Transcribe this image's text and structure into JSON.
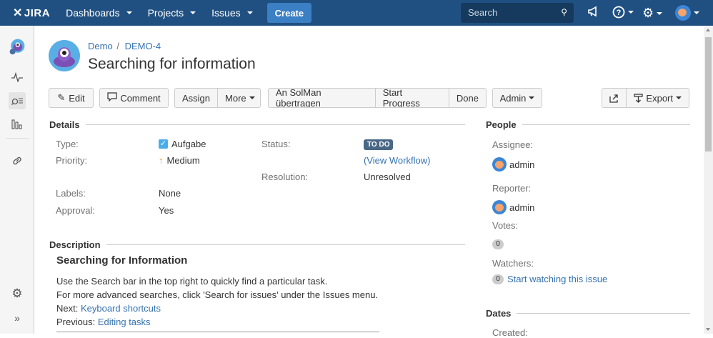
{
  "topnav": {
    "logo": "JIRA",
    "items": [
      "Dashboards",
      "Projects",
      "Issues"
    ],
    "create": "Create",
    "search_placeholder": "Search"
  },
  "breadcrumb": {
    "project": "Demo",
    "separator": "/",
    "issue_key": "DEMO-4"
  },
  "title": "Searching for information",
  "toolbar": {
    "edit": "Edit",
    "comment": "Comment",
    "assign": "Assign",
    "more": "More",
    "solman": "An SolMan übertragen",
    "start_progress": "Start Progress",
    "done": "Done",
    "admin": "Admin",
    "export": "Export"
  },
  "details": {
    "heading": "Details",
    "type_label": "Type:",
    "type_value": "Aufgabe",
    "priority_label": "Priority:",
    "priority_value": "Medium",
    "labels_label": "Labels:",
    "labels_value": "None",
    "approval_label": "Approval:",
    "approval_value": "Yes",
    "status_label": "Status:",
    "status_value": "TO DO",
    "workflow_link": "(View Workflow)",
    "resolution_label": "Resolution:",
    "resolution_value": "Unresolved"
  },
  "description": {
    "heading": "Description",
    "title": "Searching for Information",
    "line1": "Use the Search bar in the top right to quickly find a particular task.",
    "line2": "For more advanced searches, click 'Search for issues' under the Issues menu.",
    "next_label": "Next:",
    "next_link": "Keyboard shortcuts",
    "prev_label": "Previous:",
    "prev_link": "Editing tasks"
  },
  "people": {
    "heading": "People",
    "assignee_label": "Assignee:",
    "assignee": "admin",
    "reporter_label": "Reporter:",
    "reporter": "admin",
    "votes_label": "Votes:",
    "votes": "0",
    "watchers_label": "Watchers:",
    "watchers": "0",
    "watch_link": "Start watching this issue"
  },
  "dates": {
    "heading": "Dates",
    "created_label": "Created:"
  },
  "colors": {
    "nav": "#205081",
    "create": "#3b7fc4",
    "link": "#3572b0",
    "status": "#4a6785"
  }
}
